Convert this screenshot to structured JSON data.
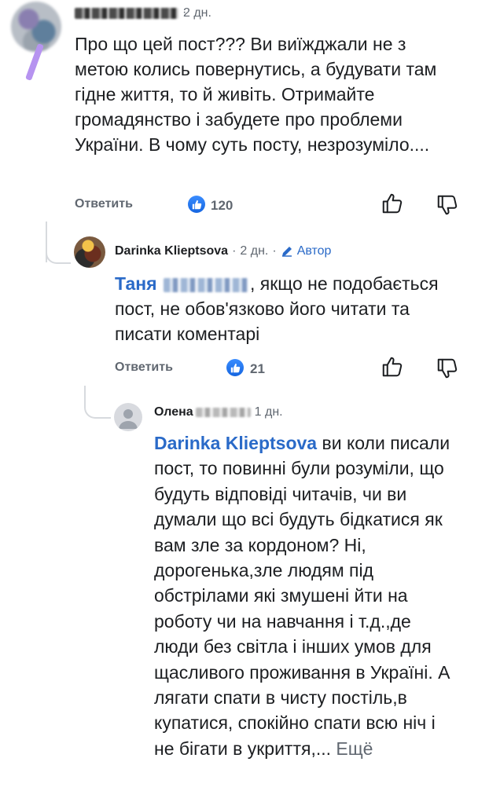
{
  "comments": [
    {
      "time": "2 дн.",
      "text": "Про що цей пост??? Ви виїжджали не з метою колись повернутись, а будувати там гідне життя, то й живіть. Отримайте громадянство і забудете про проблеми України. В чому суть посту, незрозуміло....",
      "reply_label": "Ответить",
      "like_count": "120"
    },
    {
      "author": "Darinka Klieptsova",
      "time": "2 дн.",
      "author_badge": "Автор",
      "mention": "Таня",
      "text": "якщо не подобається пост, не обов'язково його читати та писати коментарі",
      "reply_label": "Ответить",
      "like_count": "21"
    },
    {
      "author": "Олена",
      "time": "1 дн.",
      "mention": "Darinka Klieptsova",
      "text": "ви коли писали пост, то повинні були розуміли, що будуть відповіді читачів, чи ви думали що всі будуть бідкатися як вам зле за кордоном? Ні, дорогенька,зле людям під обстрілами які змушені йти на роботу чи на навчання і т.д.,де люди без світла і інших умов для щасливого проживання в Україні. А лягати спати в чисту постіль,в купатися, спокійно спати всю ніч і не бігати в укриття,...",
      "more_label": "Ещё"
    }
  ],
  "colors": {
    "accent": "#2a6ac8",
    "like": "#1877f2",
    "muted": "#606770"
  }
}
